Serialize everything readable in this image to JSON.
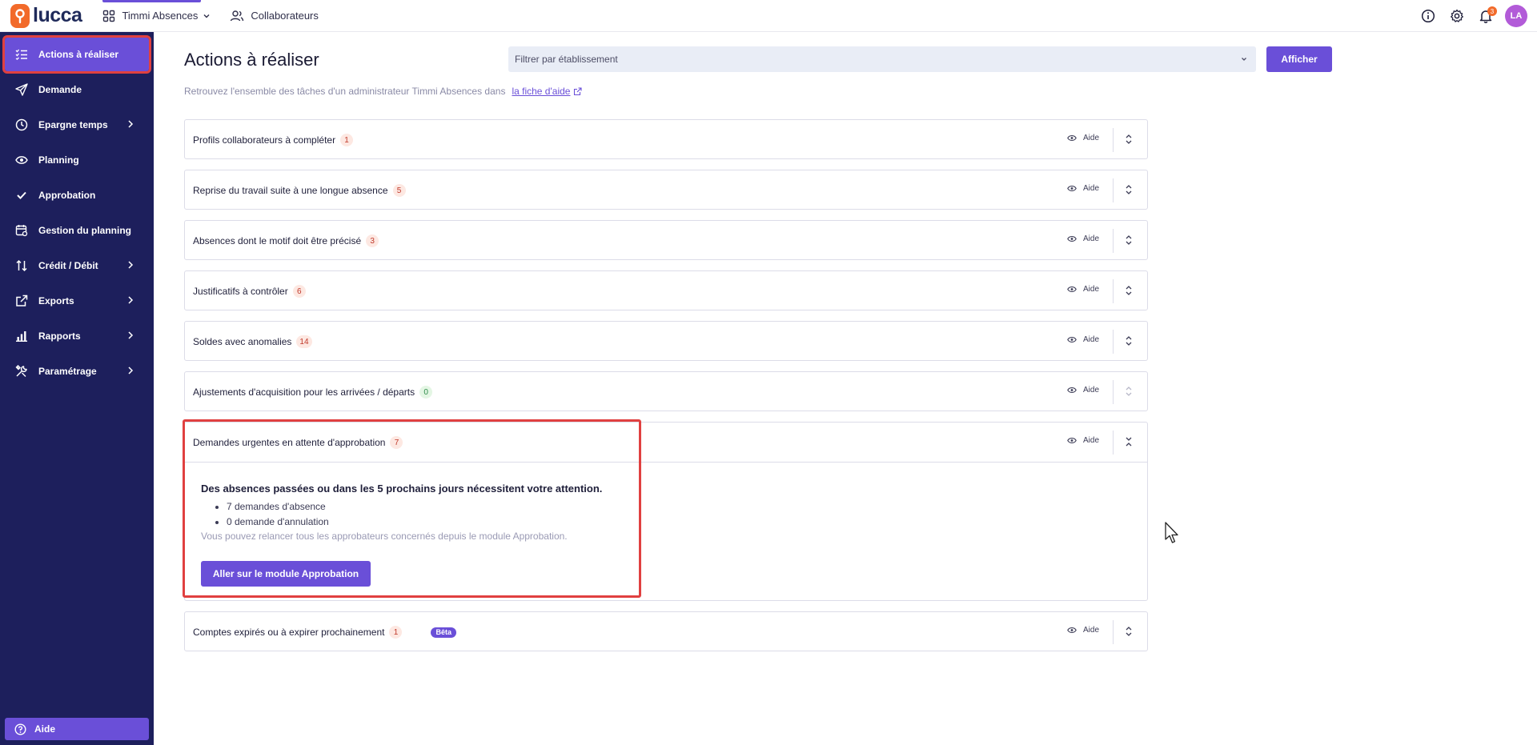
{
  "topbar": {
    "brand": "lucca",
    "app_switch": "Timmi Absences",
    "collaborateurs": "Collaborateurs",
    "notif_count": "3",
    "avatar_initials": "LA"
  },
  "sidebar": {
    "items": [
      {
        "label": "Actions à réaliser",
        "icon": "checklist-icon",
        "active": true
      },
      {
        "label": "Demande",
        "icon": "paper-plane-icon"
      },
      {
        "label": "Epargne temps",
        "icon": "clock-icon",
        "submenu": true
      },
      {
        "label": "Planning",
        "icon": "eye-icon"
      },
      {
        "label": "Approbation",
        "icon": "check-icon"
      },
      {
        "label": "Gestion du planning",
        "icon": "calendar-gear-icon"
      },
      {
        "label": "Crédit / Débit",
        "icon": "arrows-updown-icon",
        "submenu": true
      },
      {
        "label": "Exports",
        "icon": "external-link-icon",
        "submenu": true
      },
      {
        "label": "Rapports",
        "icon": "bar-chart-icon",
        "submenu": true
      },
      {
        "label": "Paramétrage",
        "icon": "tools-icon",
        "submenu": true
      }
    ],
    "help": "Aide"
  },
  "main": {
    "title": "Actions à réaliser",
    "filter_placeholder": "Filtrer par établissement",
    "show_button": "Afficher",
    "subtitle": "Retrouvez l'ensemble des tâches d'un administrateur Timmi Absences dans",
    "subtitle_link": "la fiche d'aide",
    "aide_label": "Aide",
    "cards": [
      {
        "label": "Profils collaborateurs à compléter",
        "count": "1"
      },
      {
        "label": "Reprise du travail suite à une longue absence",
        "count": "5"
      },
      {
        "label": "Absences dont le motif doit être précisé",
        "count": "3"
      },
      {
        "label": "Justificatifs à contrôler",
        "count": "6"
      },
      {
        "label": "Soldes avec anomalies",
        "count": "14"
      },
      {
        "label": "Ajustements d'acquisition pour les arrivées / départs",
        "count": "0"
      },
      {
        "label": "Demandes urgentes en attente d'approbation",
        "count": "7"
      },
      {
        "label": "Comptes expirés ou à expirer prochainement",
        "count": "1",
        "badge": "Bêta"
      }
    ],
    "expanded": {
      "lead": "Des absences passées ou dans les 5 prochains jours nécessitent votre attention.",
      "items": [
        "7 demandes d'absence",
        "0 demande d'annulation"
      ],
      "note": "Vous pouvez relancer tous les approbateurs concernés depuis le module Approbation.",
      "button": "Aller sur le module Approbation"
    }
  }
}
